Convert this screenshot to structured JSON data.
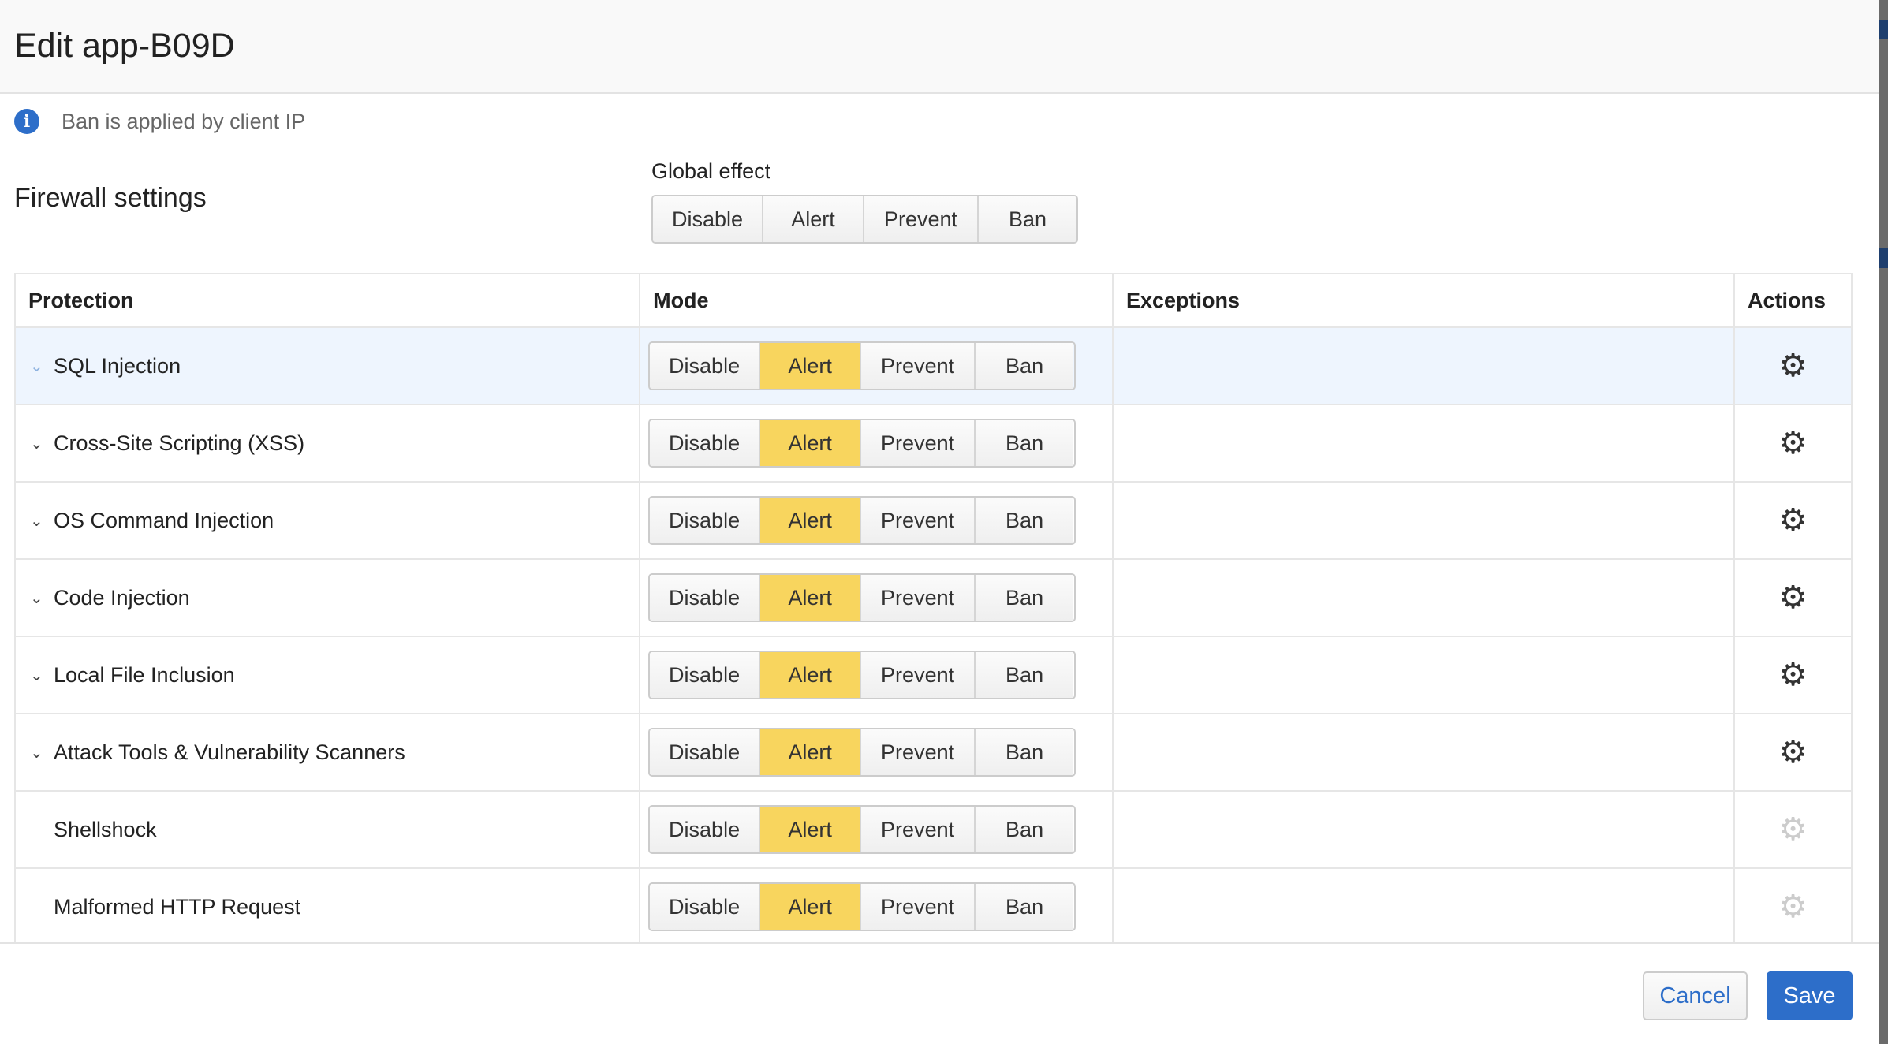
{
  "title": "Edit app-B09D",
  "info": {
    "icon": "info-icon",
    "text": "Ban is applied by client IP"
  },
  "section_title": "Firewall settings",
  "global_effect": {
    "label": "Global effect",
    "options": [
      "Disable",
      "Alert",
      "Prevent",
      "Ban"
    ],
    "selected": null
  },
  "table": {
    "headers": [
      "Protection",
      "Mode",
      "Exceptions",
      "Actions"
    ],
    "mode_options": [
      "Disable",
      "Alert",
      "Prevent",
      "Ban"
    ],
    "rows": [
      {
        "name": "SQL Injection",
        "expandable": true,
        "mode": "Alert",
        "exceptions": "",
        "actions_enabled": true,
        "highlighted": true
      },
      {
        "name": "Cross-Site Scripting (XSS)",
        "expandable": true,
        "mode": "Alert",
        "exceptions": "",
        "actions_enabled": true
      },
      {
        "name": "OS Command Injection",
        "expandable": true,
        "mode": "Alert",
        "exceptions": "",
        "actions_enabled": true
      },
      {
        "name": "Code Injection",
        "expandable": true,
        "mode": "Alert",
        "exceptions": "",
        "actions_enabled": true
      },
      {
        "name": "Local File Inclusion",
        "expandable": true,
        "mode": "Alert",
        "exceptions": "",
        "actions_enabled": true
      },
      {
        "name": "Attack Tools & Vulnerability Scanners",
        "expandable": true,
        "mode": "Alert",
        "exceptions": "",
        "actions_enabled": true
      },
      {
        "name": "Shellshock",
        "expandable": false,
        "mode": "Alert",
        "exceptions": "",
        "actions_enabled": false
      },
      {
        "name": "Malformed HTTP Request",
        "expandable": false,
        "mode": "Alert",
        "exceptions": "",
        "actions_enabled": false
      }
    ]
  },
  "footer": {
    "cancel": "Cancel",
    "save": "Save"
  },
  "colors": {
    "accent": "#2d6ec9",
    "selected_mode": "#f8d55e",
    "row_highlight": "#eef5fe"
  }
}
